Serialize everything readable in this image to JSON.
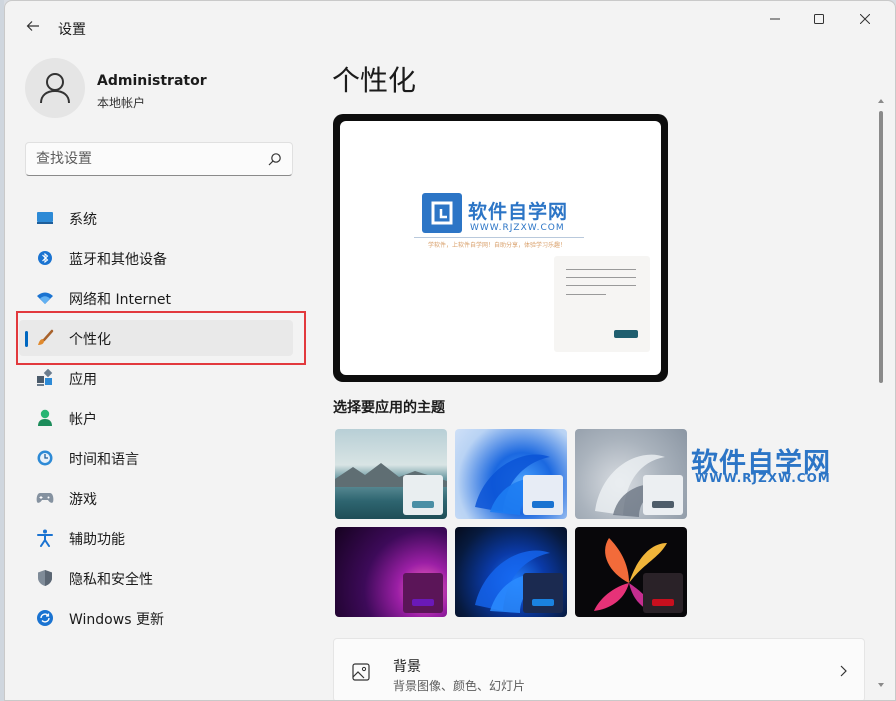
{
  "window": {
    "title": "设置"
  },
  "user": {
    "name": "Administrator",
    "account_type": "本地帐户"
  },
  "search": {
    "placeholder": "查找设置"
  },
  "sidebar": {
    "items": [
      {
        "label": "系统",
        "icon": "system-icon"
      },
      {
        "label": "蓝牙和其他设备",
        "icon": "bluetooth-icon"
      },
      {
        "label": "网络和 Internet",
        "icon": "wifi-icon"
      },
      {
        "label": "个性化",
        "icon": "brush-icon",
        "selected": true
      },
      {
        "label": "应用",
        "icon": "apps-icon"
      },
      {
        "label": "帐户",
        "icon": "account-icon"
      },
      {
        "label": "时间和语言",
        "icon": "time-language-icon"
      },
      {
        "label": "游戏",
        "icon": "gamepad-icon"
      },
      {
        "label": "辅助功能",
        "icon": "accessibility-icon"
      },
      {
        "label": "隐私和安全性",
        "icon": "shield-icon"
      },
      {
        "label": "Windows 更新",
        "icon": "update-icon"
      }
    ]
  },
  "main": {
    "page_title": "个性化",
    "themes_label": "选择要应用的主题",
    "watermark": {
      "title": "软件自学网",
      "url": "WWW.RJZXW.COM",
      "tagline": "学软件，上软件自学网！自助分享，体验学习乐趣！"
    },
    "card": {
      "title": "背景",
      "subtitle": "背景图像、颜色、幻灯片"
    }
  },
  "colors": {
    "accent": "#0067c0",
    "highlight_box": "#e2393d",
    "watermark_blue": "#2c75c6"
  }
}
